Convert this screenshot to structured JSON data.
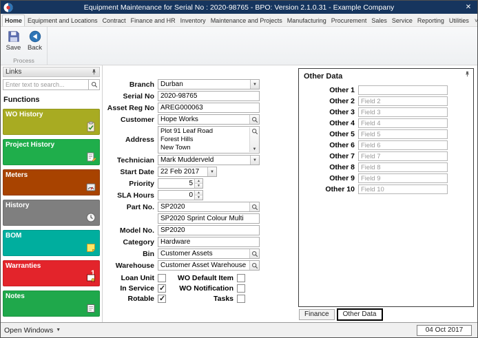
{
  "window": {
    "title": "Equipment Maintenance for Serial No : 2020-98765 - BPO: Version 2.1.0.31 - Example Company",
    "titlebar_color": "#16355e"
  },
  "ribbon": {
    "tabs": [
      "Home",
      "Equipment and Locations",
      "Contract",
      "Finance and HR",
      "Inventory",
      "Maintenance and Projects",
      "Manufacturing",
      "Procurement",
      "Sales",
      "Service",
      "Reporting",
      "Utilities"
    ],
    "active_tab": "Home",
    "save_label": "Save",
    "back_label": "Back",
    "group_label": "Process"
  },
  "sidebar": {
    "header": "Links",
    "search_placeholder": "Enter text to search...",
    "functions_label": "Functions",
    "items": [
      {
        "label": "WO History",
        "color": "#a8ab22",
        "icon": "clipboard-check-icon"
      },
      {
        "label": "Project History",
        "color": "#1fae4b",
        "icon": "project-doc-icon"
      },
      {
        "label": "Meters",
        "color": "#a84300",
        "icon": "meter-icon"
      },
      {
        "label": "History",
        "color": "#7f7f7f",
        "icon": "clock-icon"
      },
      {
        "label": "BOM",
        "color": "#00ae9e",
        "icon": "sticky-note-icon"
      },
      {
        "label": "Warranties",
        "color": "#e3242b",
        "icon": "certificate-icon",
        "badge": "1"
      },
      {
        "label": "Notes",
        "color": "#1fa84b",
        "icon": "notes-icon"
      }
    ]
  },
  "form": {
    "fields": {
      "branch": {
        "label": "Branch",
        "value": "Durban"
      },
      "serial_no": {
        "label": "Serial No",
        "value": "2020-98765"
      },
      "asset_reg_no": {
        "label": "Asset Reg No",
        "value": "AREG000063"
      },
      "customer": {
        "label": "Customer",
        "value": "Hope Works"
      },
      "address": {
        "label": "Address",
        "value": "Plot 91 Leaf Road\nForest Hills\nNew Town"
      },
      "technician": {
        "label": "Technician",
        "value": "Mark Mudderveld"
      },
      "start_date": {
        "label": "Start Date",
        "value": "22 Feb 2017"
      },
      "priority": {
        "label": "Priority",
        "value": "5"
      },
      "sla_hours": {
        "label": "SLA Hours",
        "value": "0"
      },
      "part_no": {
        "label": "Part No.",
        "value": "SP2020",
        "description": "SP2020 Sprint Colour Multi"
      },
      "model_no": {
        "label": "Model No.",
        "value": "SP2020"
      },
      "category": {
        "label": "Category",
        "value": "Hardware"
      },
      "bin": {
        "label": "Bin",
        "value": "Customer Assets"
      },
      "warehouse": {
        "label": "Warehouse",
        "value": "Customer Asset Warehouse"
      }
    },
    "checkboxes": [
      {
        "label": "Loan Unit",
        "checked": false
      },
      {
        "label": "WO Default Item",
        "checked": false
      },
      {
        "label": "In Service",
        "checked": true
      },
      {
        "label": "WO Notification",
        "checked": false
      },
      {
        "label": "Rotable",
        "checked": true
      },
      {
        "label": "Tasks",
        "checked": false
      }
    ]
  },
  "other_data": {
    "title": "Other Data",
    "rows": [
      {
        "label": "Other 1",
        "placeholder": ""
      },
      {
        "label": "Other 2",
        "placeholder": "Field 2"
      },
      {
        "label": "Other 3",
        "placeholder": "Field 3"
      },
      {
        "label": "Other 4",
        "placeholder": "Field 4"
      },
      {
        "label": "Other 5",
        "placeholder": "Field 5"
      },
      {
        "label": "Other 6",
        "placeholder": "Field 6"
      },
      {
        "label": "Other 7",
        "placeholder": "Field 7"
      },
      {
        "label": "Other 8",
        "placeholder": "Field 8"
      },
      {
        "label": "Other 9",
        "placeholder": "Field 9"
      },
      {
        "label": "Other 10",
        "placeholder": "Field 10"
      }
    ],
    "tabs": [
      {
        "label": "Finance",
        "active": false
      },
      {
        "label": "Other Data",
        "active": true
      }
    ]
  },
  "status_bar": {
    "open_windows_label": "Open Windows",
    "date": "04 Oct 2017"
  }
}
